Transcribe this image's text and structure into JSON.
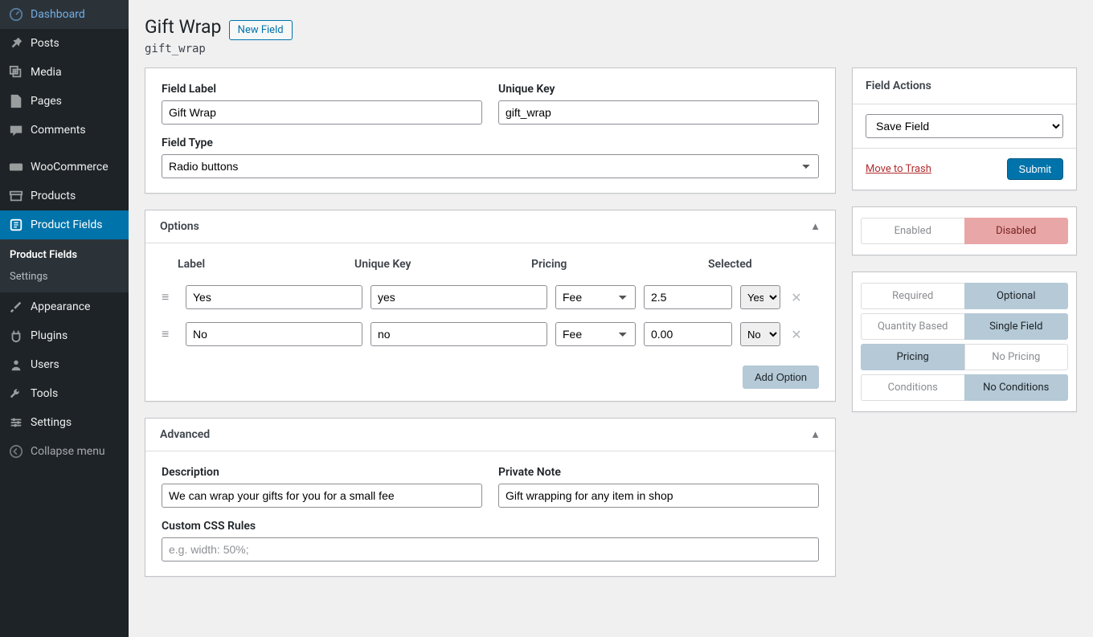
{
  "sidebar": {
    "items": [
      {
        "label": "Dashboard",
        "icon": "dashboard"
      },
      {
        "label": "Posts",
        "icon": "pin"
      },
      {
        "label": "Media",
        "icon": "media"
      },
      {
        "label": "Pages",
        "icon": "page"
      },
      {
        "label": "Comments",
        "icon": "comment"
      },
      {
        "label": "WooCommerce",
        "icon": "woo"
      },
      {
        "label": "Products",
        "icon": "archive"
      },
      {
        "label": "Product Fields",
        "icon": "edit",
        "current": true
      },
      {
        "label": "Appearance",
        "icon": "brush"
      },
      {
        "label": "Plugins",
        "icon": "plugin"
      },
      {
        "label": "Users",
        "icon": "user"
      },
      {
        "label": "Tools",
        "icon": "tool"
      },
      {
        "label": "Settings",
        "icon": "gear"
      },
      {
        "label": "Collapse menu",
        "icon": "collapse"
      }
    ],
    "submenu": [
      {
        "label": "Product Fields",
        "current": true
      },
      {
        "label": "Settings"
      }
    ]
  },
  "header": {
    "title": "Gift Wrap",
    "new_field": "New Field",
    "slug": "gift_wrap"
  },
  "field_box": {
    "label_text": "Field Label",
    "label_value": "Gift Wrap",
    "key_text": "Unique Key",
    "key_value": "gift_wrap",
    "type_text": "Field Type",
    "type_value": "Radio buttons"
  },
  "options_box": {
    "title": "Options",
    "headers": {
      "label": "Label",
      "key": "Unique Key",
      "pricing": "Pricing",
      "selected": "Selected"
    },
    "rows": [
      {
        "label": "Yes",
        "key": "yes",
        "pricing": "Fee",
        "price": "2.5",
        "selected": "Yes"
      },
      {
        "label": "No",
        "key": "no",
        "pricing": "Fee",
        "price": "0.00",
        "selected": "No"
      }
    ],
    "add_option": "Add Option"
  },
  "advanced_box": {
    "title": "Advanced",
    "description_label": "Description",
    "description_value": "We can wrap your gifts for you for a small fee",
    "private_label": "Private Note",
    "private_value": "Gift wrapping for any item in shop",
    "css_label": "Custom CSS Rules",
    "css_placeholder": "e.g. width: 50%;"
  },
  "actions_box": {
    "title": "Field Actions",
    "save_label": "Save Field",
    "trash": "Move to Trash",
    "submit": "Submit"
  },
  "toggles": [
    {
      "left": "Enabled",
      "right": "Disabled",
      "active": "right",
      "red": true
    },
    {
      "left": "Required",
      "right": "Optional",
      "active": "right"
    },
    {
      "left": "Quantity Based",
      "right": "Single Field",
      "active": "right"
    },
    {
      "left": "Pricing",
      "right": "No Pricing",
      "active": "left"
    },
    {
      "left": "Conditions",
      "right": "No Conditions",
      "active": "right"
    }
  ]
}
